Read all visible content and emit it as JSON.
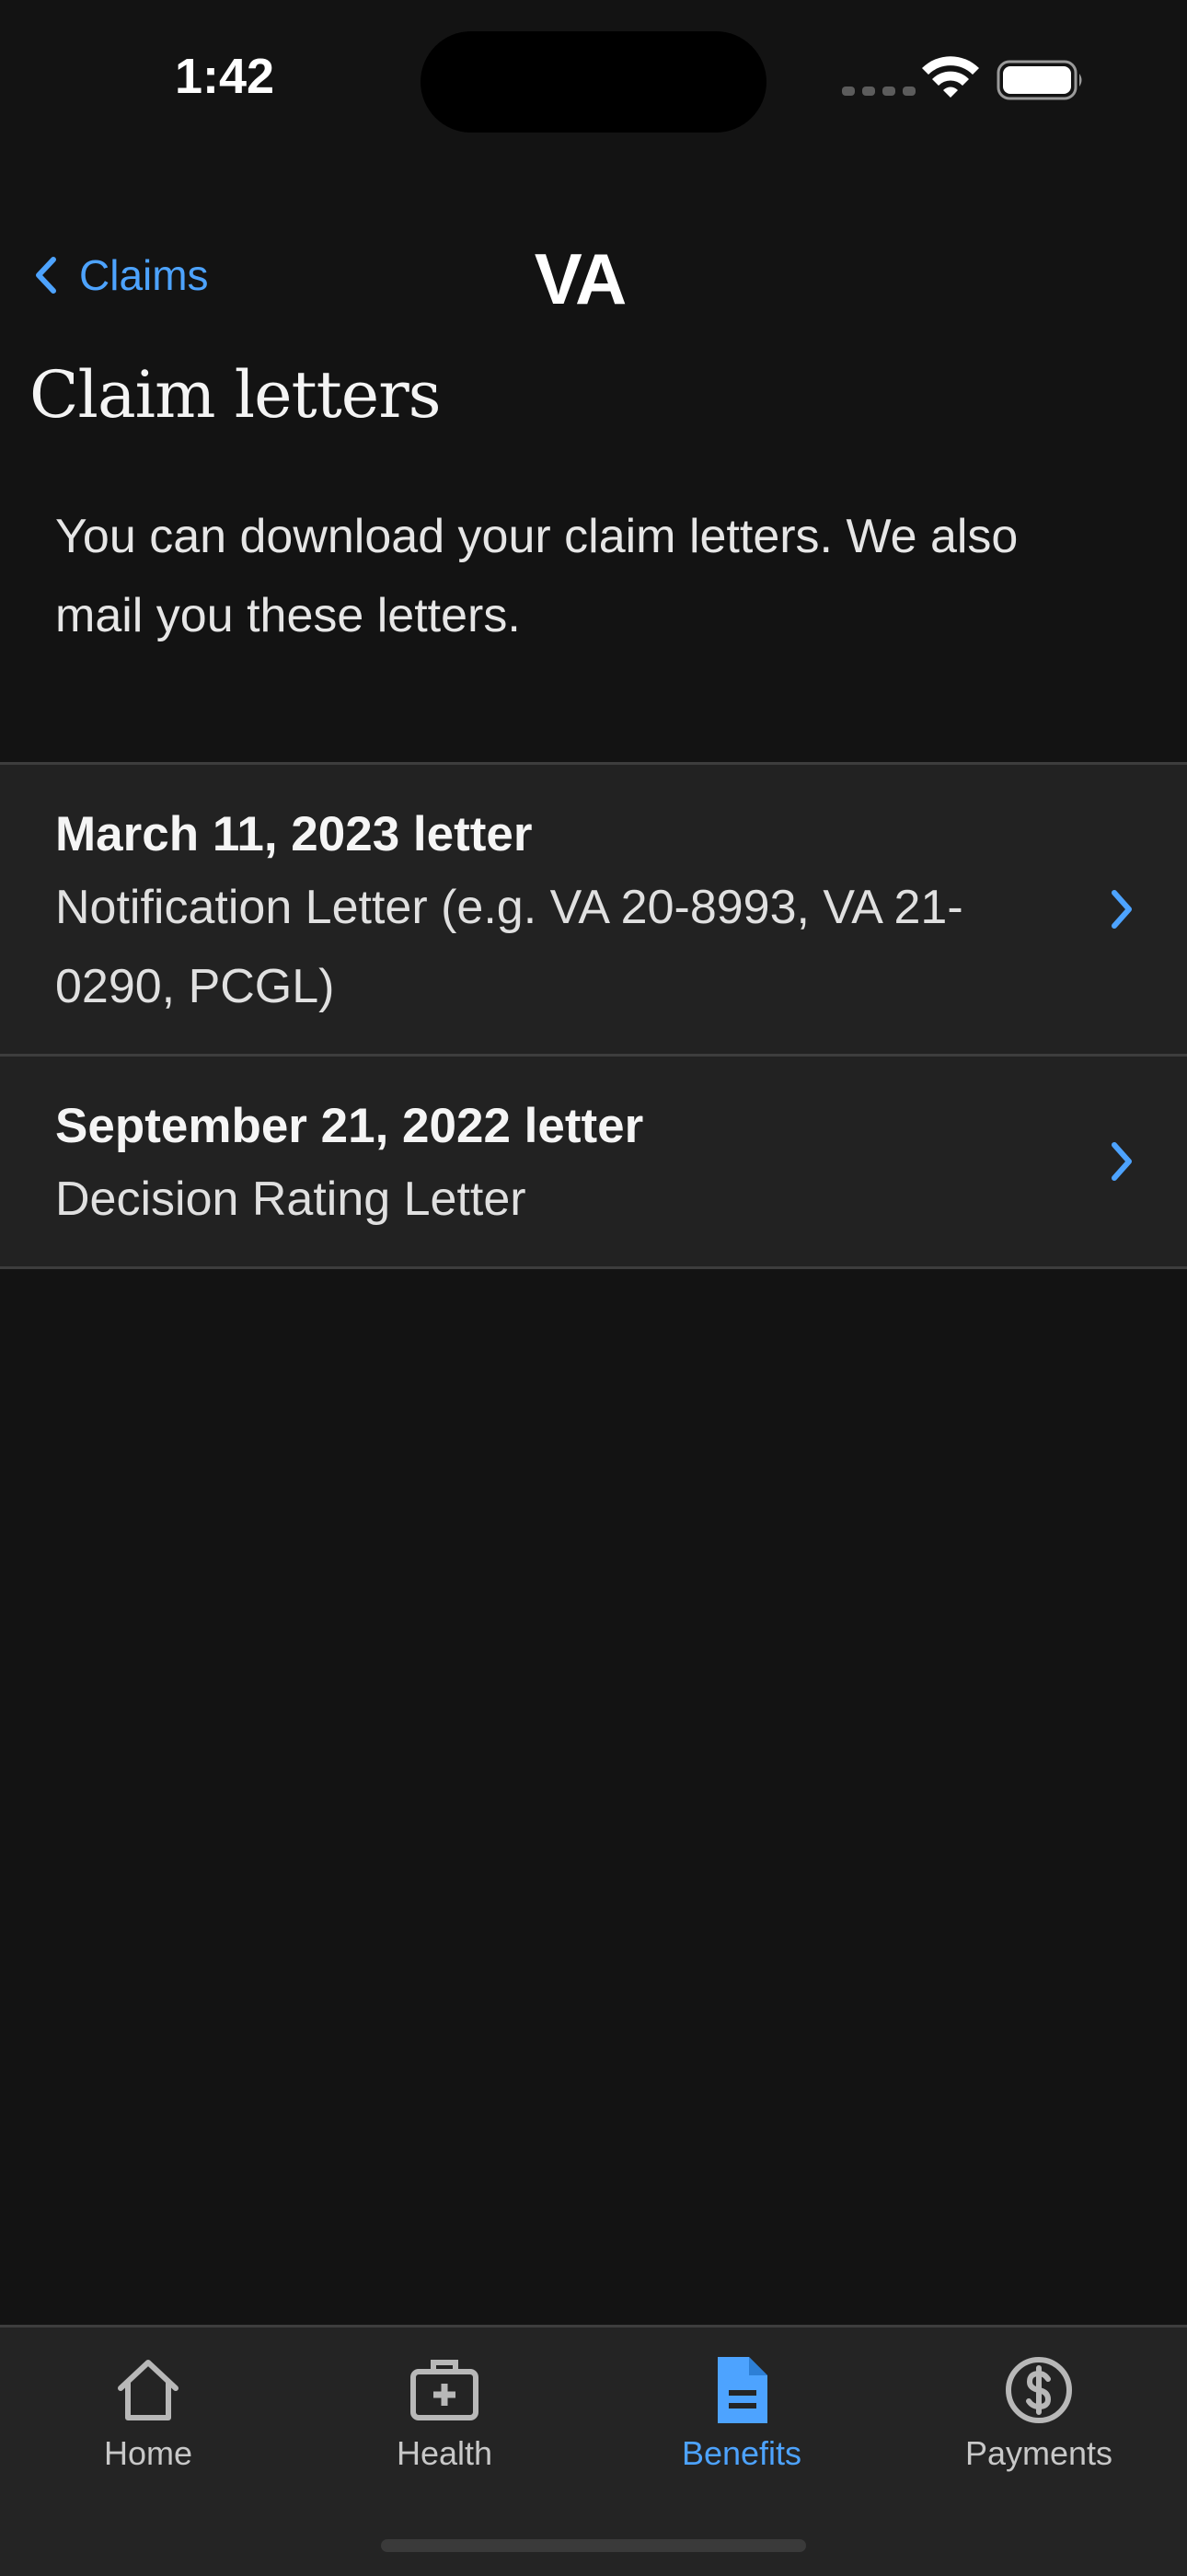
{
  "status_bar": {
    "time": "1:42"
  },
  "nav": {
    "back_label": "Claims",
    "logo_text": "VA"
  },
  "page": {
    "title": "Claim letters",
    "intro": "You can download your claim letters. We also mail you these letters."
  },
  "letters": [
    {
      "date": "March 11, 2023 letter",
      "type": "Notification Letter (e.g. VA 20-8993, VA 21-0290, PCGL)"
    },
    {
      "date": "September 21, 2022 letter",
      "type": "Decision Rating Letter"
    }
  ],
  "tabs": [
    {
      "label": "Home",
      "icon": "home-icon",
      "active": false
    },
    {
      "label": "Health",
      "icon": "medical-kit-icon",
      "active": false
    },
    {
      "label": "Benefits",
      "icon": "document-icon",
      "active": true
    },
    {
      "label": "Payments",
      "icon": "dollar-circle-icon",
      "active": false
    }
  ],
  "colors": {
    "accent": "#4da3ff",
    "background": "#131313",
    "surface": "#222222",
    "divider": "#3d3d3d"
  }
}
